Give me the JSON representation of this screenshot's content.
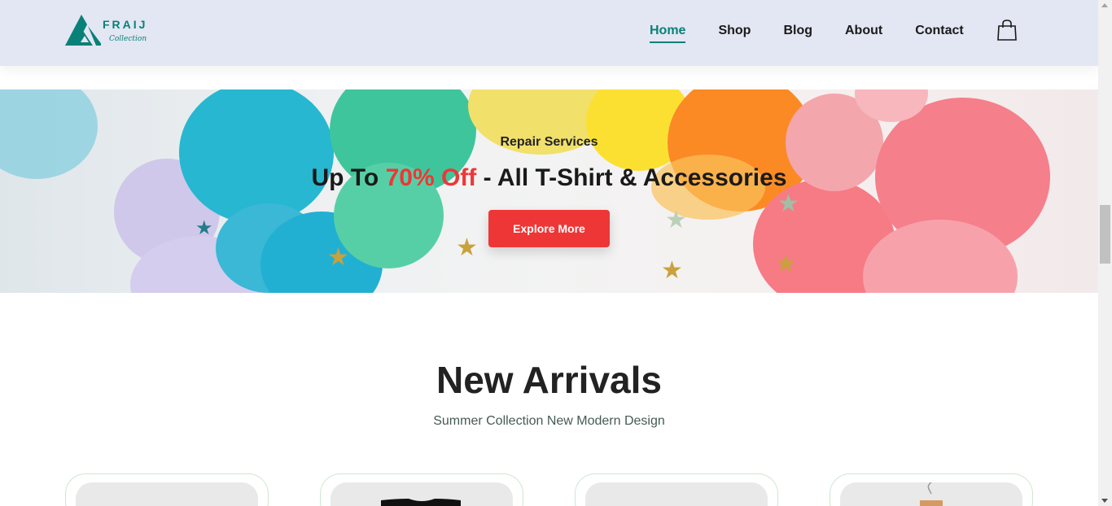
{
  "brand": {
    "name": "FRAIJ",
    "tagline": "Collection",
    "color": "#088178"
  },
  "nav": {
    "items": [
      {
        "label": "Home",
        "active": true
      },
      {
        "label": "Shop",
        "active": false
      },
      {
        "label": "Blog",
        "active": false
      },
      {
        "label": "About",
        "active": false
      },
      {
        "label": "Contact",
        "active": false
      }
    ],
    "cart_icon": "shopping-bag-icon"
  },
  "hero": {
    "subtitle": "Repair Services",
    "title_prefix": "Up To ",
    "title_highlight": "70% Off",
    "title_suffix": " - All T-Shirt & Accessories",
    "button_label": "Explore More",
    "accent_color": "#ef3636"
  },
  "new_arrivals": {
    "title": "New Arrivals",
    "subtitle": "Summer Collection New Modern Design"
  }
}
